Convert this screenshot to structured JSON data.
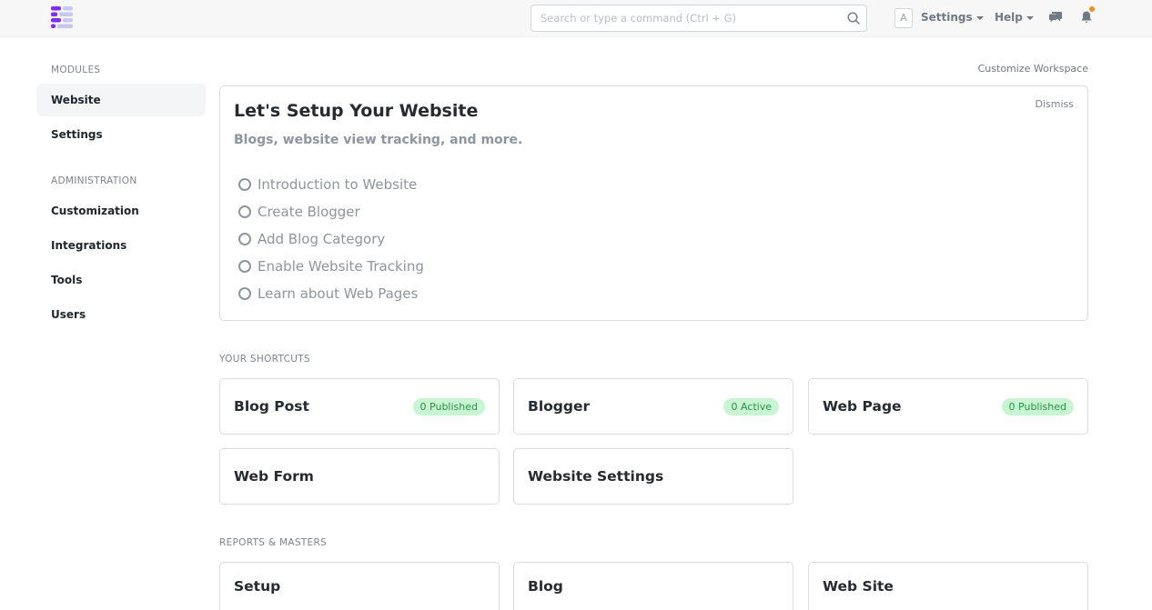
{
  "navbar": {
    "search_placeholder": "Search or type a command (Ctrl + G)",
    "avatar_letter": "A",
    "settings_label": "Settings",
    "help_label": "Help"
  },
  "sidebar": {
    "modules_heading": "MODULES",
    "modules": [
      {
        "label": "Website",
        "active": true
      },
      {
        "label": "Settings"
      }
    ],
    "admin_heading": "ADMINISTRATION",
    "admin": [
      {
        "label": "Customization"
      },
      {
        "label": "Integrations"
      },
      {
        "label": "Tools"
      },
      {
        "label": "Users"
      }
    ]
  },
  "main": {
    "customize_label": "Customize Workspace",
    "onboarding": {
      "title": "Let's Setup Your Website",
      "subtitle": "Blogs, website view tracking, and more.",
      "dismiss_label": "Dismiss",
      "steps": [
        "Introduction to Website",
        "Create Blogger",
        "Add Blog Category",
        "Enable Website Tracking",
        "Learn about Web Pages"
      ]
    },
    "shortcuts_heading": "YOUR SHORTCUTS",
    "shortcuts": [
      {
        "title": "Blog Post",
        "badge": "0 Published"
      },
      {
        "title": "Blogger",
        "badge": "0 Active"
      },
      {
        "title": "Web Page",
        "badge": "0 Published"
      },
      {
        "title": "Web Form"
      },
      {
        "title": "Website Settings"
      }
    ],
    "reports_heading": "REPORTS & MASTERS",
    "reports": [
      {
        "title": "Setup"
      },
      {
        "title": "Blog"
      },
      {
        "title": "Web Site"
      }
    ]
  },
  "colors": {
    "accent": "#7b2ff7",
    "badge_bg": "#c9f6d2",
    "badge_text": "#2a8f4a",
    "notification": "#f58c1b"
  }
}
